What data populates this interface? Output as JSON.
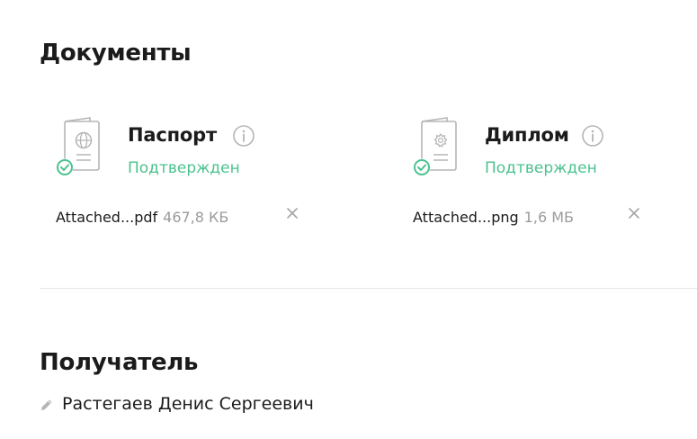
{
  "documents": {
    "title": "Документы",
    "items": [
      {
        "name": "Паспорт",
        "status": "Подтвержден",
        "file_name": "Attached...pdf",
        "file_size": "467,8 КБ",
        "icon": "passport-globe-icon"
      },
      {
        "name": "Диплом",
        "status": "Подтвержден",
        "file_name": "Attached...png",
        "file_size": "1,6 МБ",
        "icon": "diploma-seal-icon"
      }
    ]
  },
  "recipient": {
    "title": "Получатель",
    "name": "Растегаев Денис Сергеевич"
  },
  "colors": {
    "text": "#1b1b1b",
    "status_green": "#4cc28f",
    "muted": "#9b9b9b",
    "icon_gray": "#b5b5b5",
    "divider": "#e6e6e6"
  }
}
